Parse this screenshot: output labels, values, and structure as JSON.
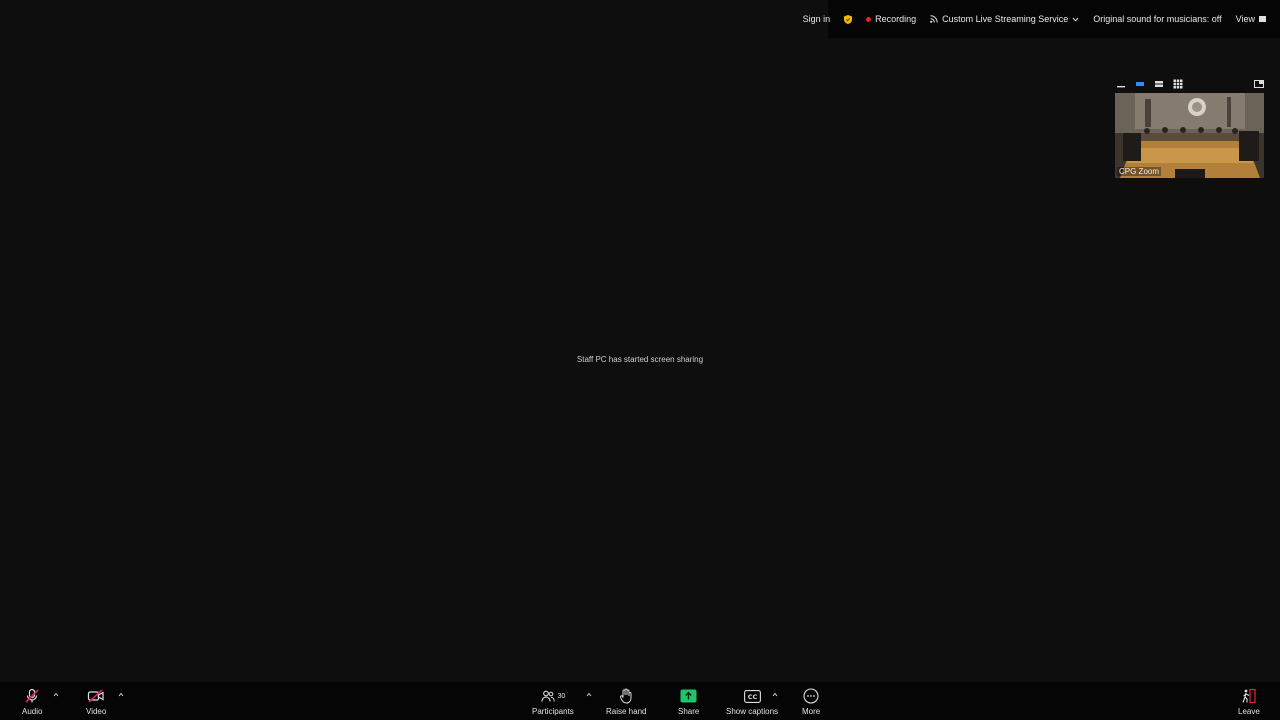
{
  "topbar": {
    "sign_in": "Sign in",
    "recording": "Recording",
    "streaming": "Custom Live Streaming Service",
    "original_sound": "Original sound for musicians: off",
    "view": "View"
  },
  "thumbnail": {
    "label": "CPG Zoom"
  },
  "center": {
    "message": "Staff PC has started screen sharing"
  },
  "toolbar": {
    "audio": "Audio",
    "video": "Video",
    "participants": "Participants",
    "participants_count": "30",
    "raise_hand": "Raise hand",
    "share": "Share",
    "show_captions": "Show captions",
    "captions_icon": "CC",
    "more": "More",
    "leave": "Leave"
  },
  "colors": {
    "share_green": "#1fc46b",
    "recording_red": "#e02828",
    "active_view_blue": "#2d8cff",
    "muted_red": "#e0234a"
  }
}
